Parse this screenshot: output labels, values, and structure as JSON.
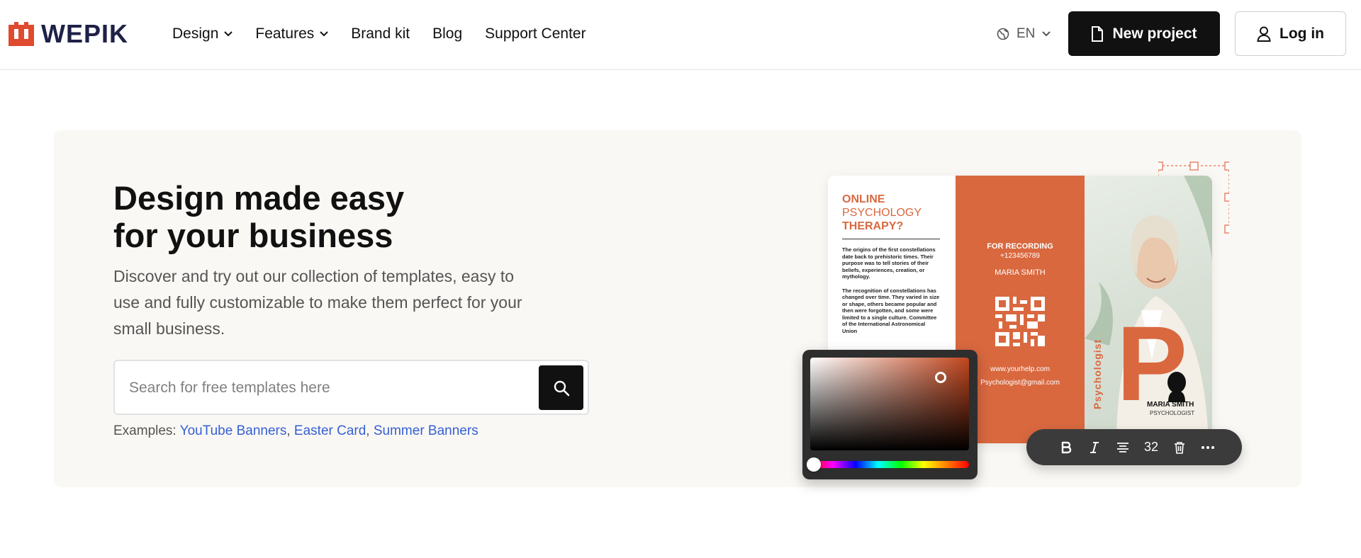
{
  "header": {
    "logo_text": "WEPIK",
    "nav": [
      {
        "label": "Design",
        "has_dropdown": true
      },
      {
        "label": "Features",
        "has_dropdown": true
      },
      {
        "label": "Brand kit",
        "has_dropdown": false
      },
      {
        "label": "Blog",
        "has_dropdown": false
      },
      {
        "label": "Support Center",
        "has_dropdown": false
      }
    ],
    "language": "EN",
    "new_project_label": "New project",
    "login_label": "Log in"
  },
  "hero": {
    "title_line1": "Design made easy",
    "title_line2": "for your business",
    "subtitle": "Discover and try out our collection of templates, easy to use and fully customizable to make them perfect for your small business.",
    "search_placeholder": "Search for free templates here",
    "examples_label": "Examples:",
    "examples": [
      "YouTube Banners",
      "Easter Card",
      "Summer Banners"
    ]
  },
  "design_preview": {
    "heading_line1": "ONLINE",
    "heading_line2": "PSYCHOLOGY",
    "heading_line3": "THERAPY?",
    "paragraph1": "The origins of the first constellations date back to prehistoric times. Their purpose was to tell stories of their beliefs, experiences, creation, or mythology.",
    "paragraph2": "The recognition of constellations has changed over time. They varied in size or shape, others became popular and then were forgotten, and some were limited to a single culture. Committee of the International Astronomical Union",
    "for_recording": "FOR RECORDING",
    "phone": "+123456789",
    "name": "MARIA SMITH",
    "website": "www.yourhelp.com",
    "email": "Psychologist@gmail.com",
    "big_letter": "P",
    "vertical_label": "Psychologist",
    "photo_name": "MARIA SMITH",
    "photo_title": "PSYCHOLOGIST"
  },
  "toolbar": {
    "font_size": "32",
    "tools": [
      "bold-icon",
      "italic-icon",
      "align-icon",
      "font-size",
      "trash-icon",
      "more-icon"
    ]
  },
  "colors": {
    "brand": "#d9683f",
    "logo_mark": "#e04a2f",
    "logo_text": "#1f2148",
    "primary_button": "#111111",
    "link": "#3560d4",
    "hero_bg": "#faf8f4"
  }
}
